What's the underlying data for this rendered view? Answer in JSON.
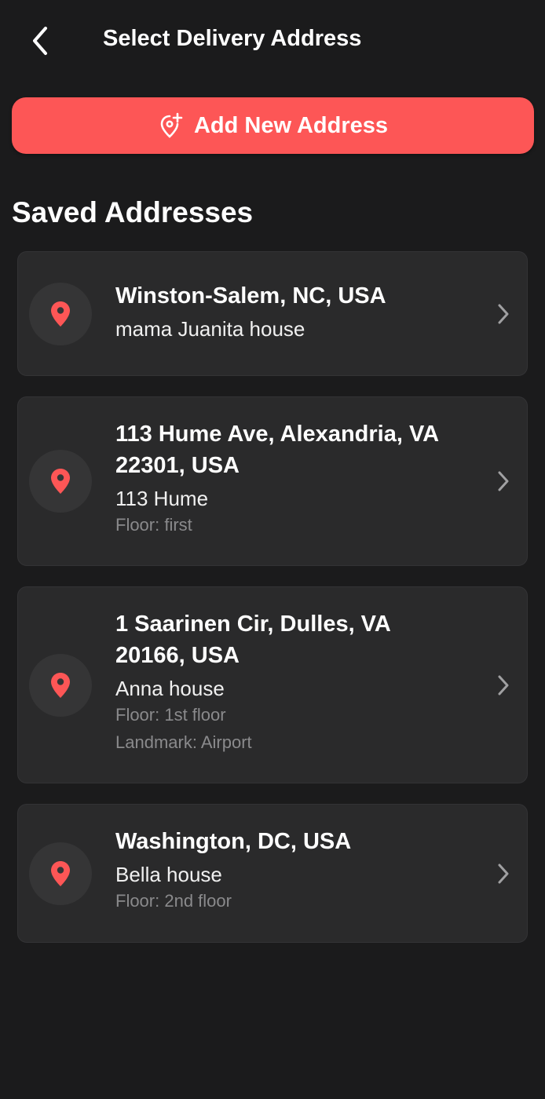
{
  "header": {
    "title": "Select Delivery Address",
    "back_icon": "chevron-left-icon"
  },
  "add_button": {
    "label": "Add New Address",
    "icon": "add-location-icon"
  },
  "section_title": "Saved Addresses",
  "colors": {
    "accent": "#fd5656",
    "background": "#1b1b1c",
    "card": "#2a2a2b",
    "muted_text": "#8a8a8c"
  },
  "addresses": [
    {
      "address": "Winston-Salem, NC, USA",
      "name": "mama Juanita house",
      "floor": "",
      "landmark": ""
    },
    {
      "address": "113 Hume Ave, Alexandria, VA 22301, USA",
      "name": "113 Hume",
      "floor": "Floor: first",
      "landmark": ""
    },
    {
      "address": "1 Saarinen Cir, Dulles, VA 20166, USA",
      "name": "Anna house",
      "floor": "Floor: 1st floor",
      "landmark": "Landmark: Airport"
    },
    {
      "address": "Washington, DC, USA",
      "name": "Bella house",
      "floor": "Floor: 2nd floor",
      "landmark": ""
    }
  ]
}
